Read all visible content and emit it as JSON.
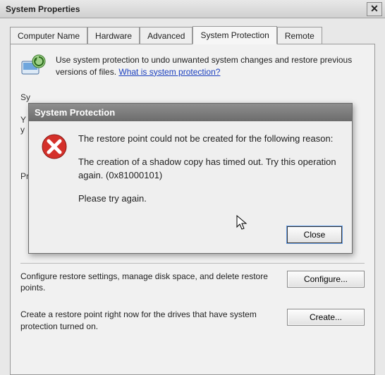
{
  "window": {
    "title": "System Properties",
    "close_glyph": "✕"
  },
  "tabs": {
    "t0": "Computer Name",
    "t1": "Hardware",
    "t2": "Advanced",
    "t3": "System Protection",
    "t4": "Remote"
  },
  "intro": {
    "text": "Use system protection to undo unwanted system changes and restore previous versions of files. ",
    "link": "What is system protection?"
  },
  "peek": {
    "section1": "Sy",
    "line1a": "Y",
    "line1b": "y",
    "section2": "Pr"
  },
  "config": {
    "text": "Configure restore settings, manage disk space, and delete restore points.",
    "button": "Configure..."
  },
  "create": {
    "text": "Create a restore point right now for the drives that have system protection turned on.",
    "button": "Create..."
  },
  "modal": {
    "title": "System Protection",
    "p1": "The restore point could not be created for the following reason:",
    "p2": "The creation of a shadow copy has timed out. Try this operation again. (0x81000101)",
    "p3": "Please try again.",
    "close": "Close"
  }
}
